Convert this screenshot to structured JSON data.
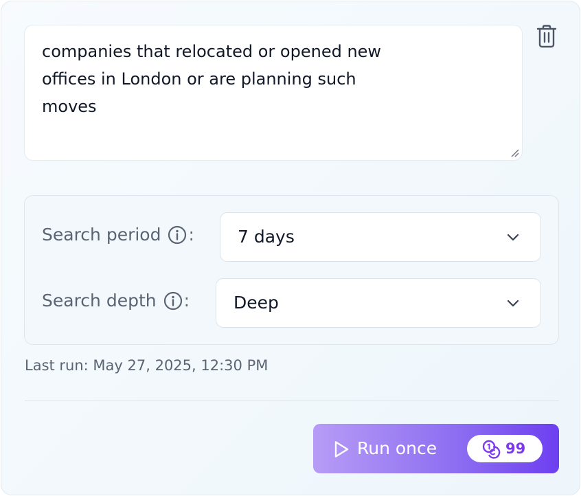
{
  "query": {
    "text": "companies that relocated or opened new\noffices in London or are planning such\nmoves"
  },
  "settings": {
    "search_period": {
      "label": "Search period",
      "colon": ":",
      "value": "7 days"
    },
    "search_depth": {
      "label": "Search depth",
      "colon": ":",
      "value": "Deep"
    }
  },
  "last_run": "Last run: May 27, 2025, 12:30 PM",
  "run_button": {
    "label": "Run once",
    "credits": "99"
  },
  "icons": {
    "delete": "trash-icon",
    "info": "info-icon",
    "dropdown": "chevron-down-icon",
    "play": "play-icon",
    "credits": "coins-icon"
  },
  "colors": {
    "accent": "#7c3aed",
    "button_gradient_start": "#b79cf6",
    "button_gradient_end": "#6d3ff0",
    "label_text": "#5b6472"
  }
}
